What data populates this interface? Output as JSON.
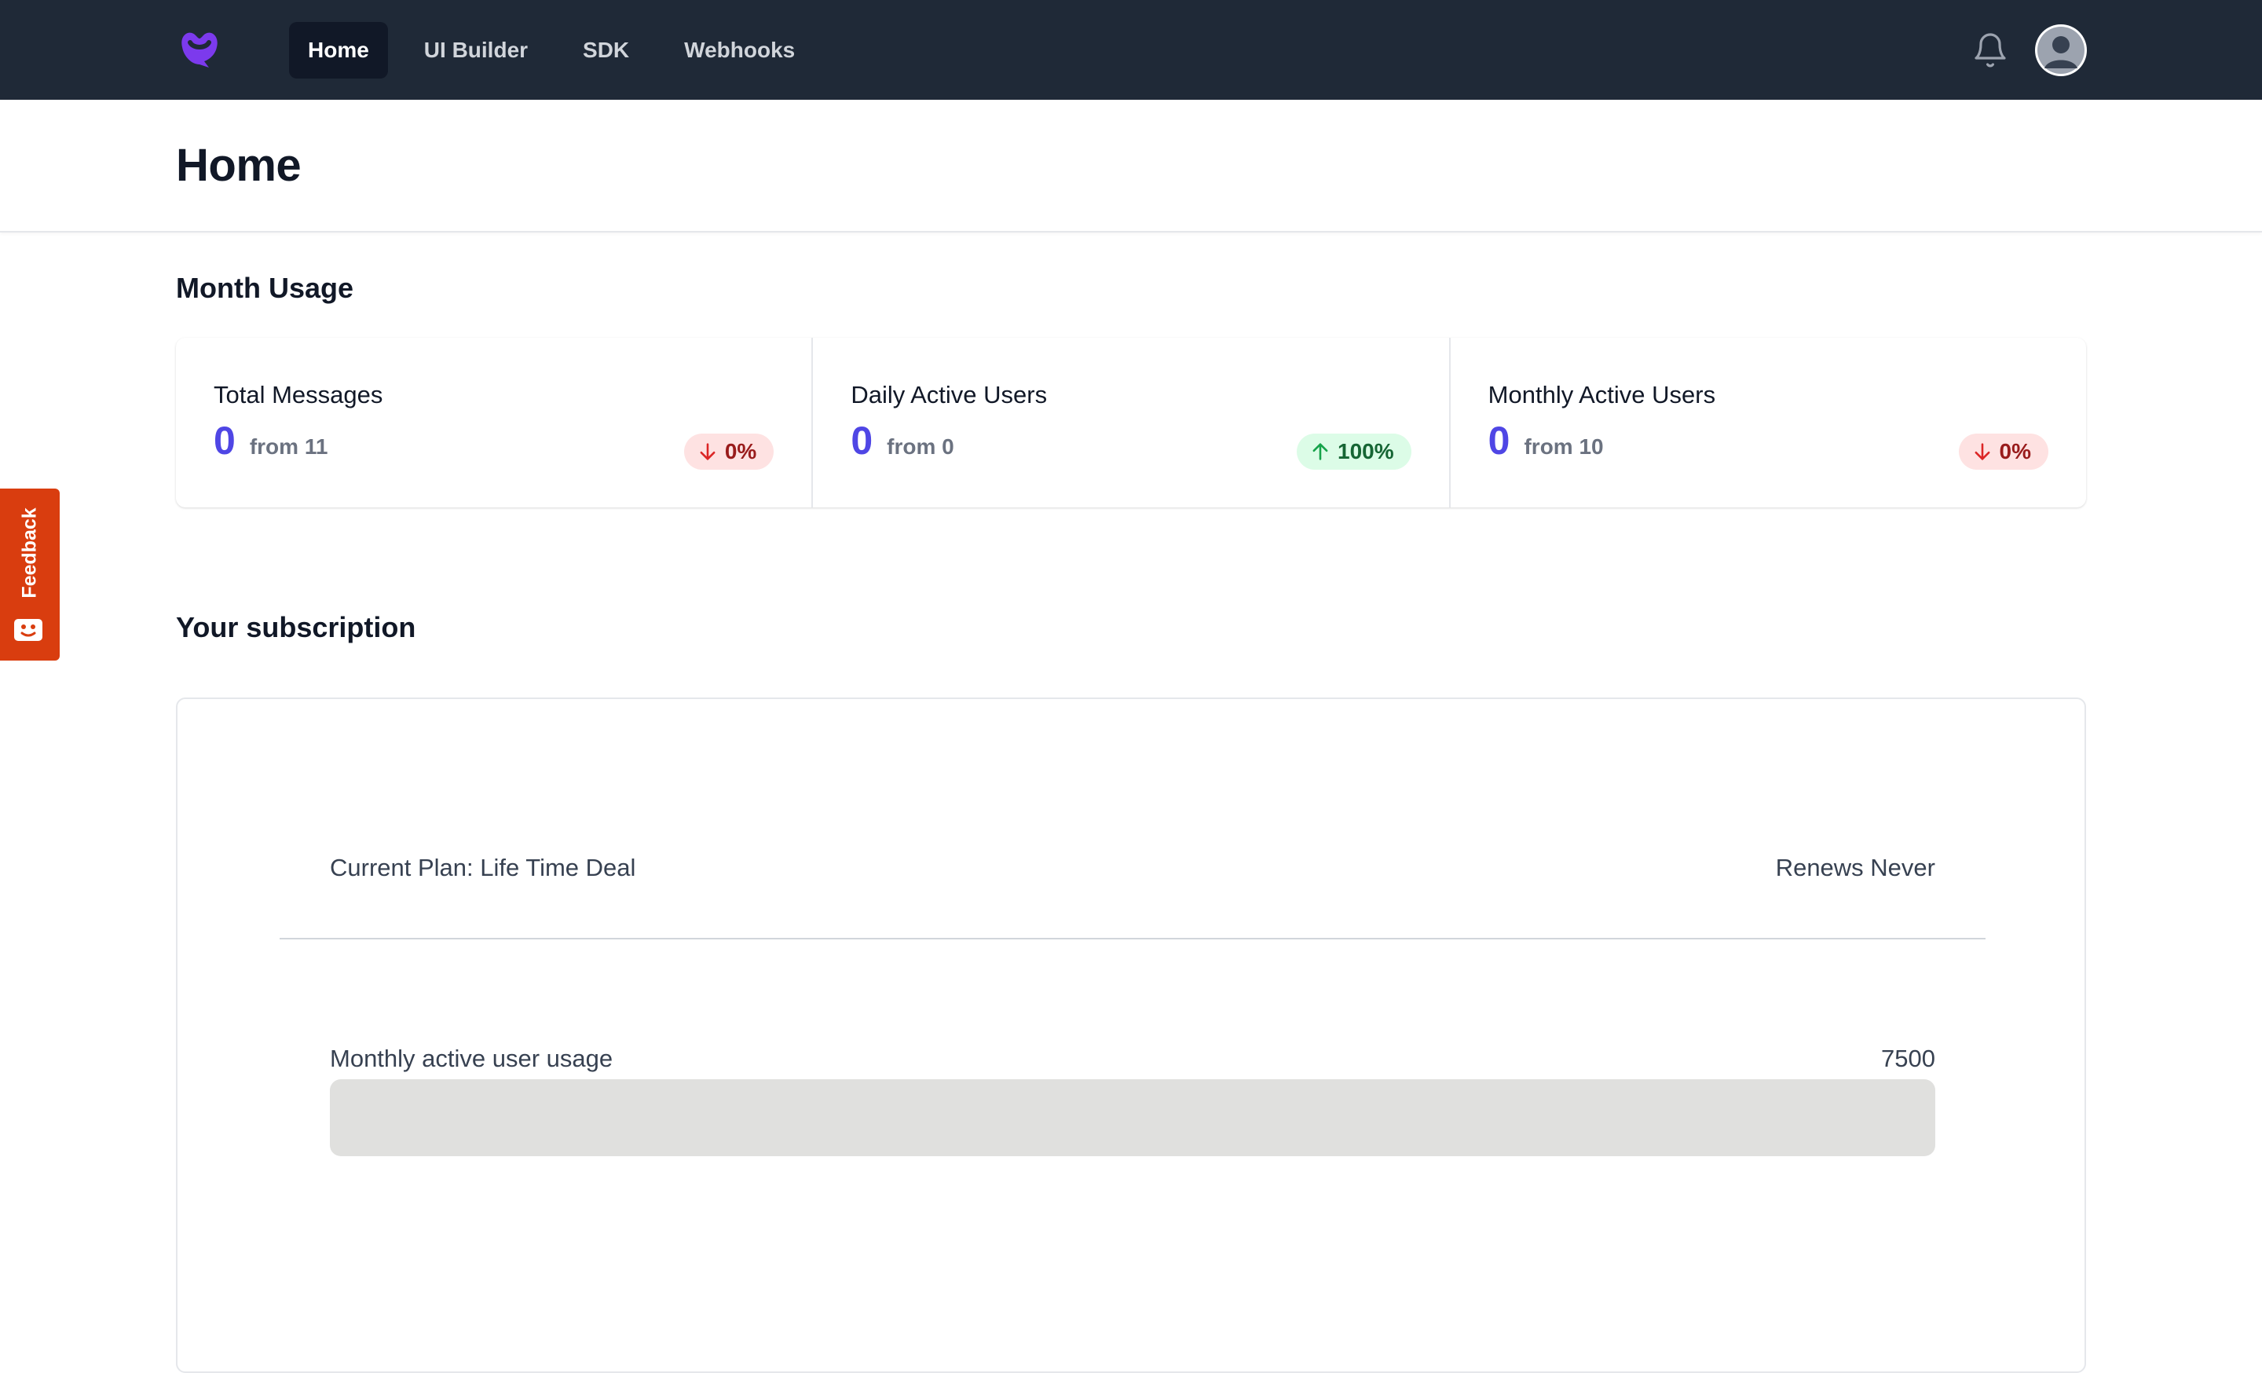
{
  "nav": {
    "tabs": [
      {
        "label": "Home",
        "active": true
      },
      {
        "label": "UI Builder",
        "active": false
      },
      {
        "label": "SDK",
        "active": false
      },
      {
        "label": "Webhooks",
        "active": false
      }
    ],
    "icons": {
      "logo": "brand-logo",
      "notifications": "bell-icon",
      "avatar": "user-avatar"
    }
  },
  "page": {
    "title": "Home"
  },
  "month_usage": {
    "title": "Month Usage",
    "stats": [
      {
        "label": "Total Messages",
        "value": "0",
        "from": "from 11",
        "change": "0%",
        "direction": "down"
      },
      {
        "label": "Daily Active Users",
        "value": "0",
        "from": "from 0",
        "change": "100%",
        "direction": "up"
      },
      {
        "label": "Monthly Active Users",
        "value": "0",
        "from": "from 10",
        "change": "0%",
        "direction": "down"
      }
    ]
  },
  "subscription": {
    "title": "Your subscription",
    "plan_label": "Current Plan: Life Time Deal",
    "renews_label": "Renews Never",
    "usage_label": "Monthly active user usage",
    "usage_limit": "7500",
    "usage_fraction": 0
  },
  "feedback": {
    "label": "Feedback"
  },
  "colors": {
    "nav_bg": "#1f2937",
    "accent": "#4f46e5",
    "down_bg": "#fee2e2",
    "down_text": "#991b1b",
    "up_bg": "#dcfce7",
    "up_text": "#166534",
    "feedback_bg": "#d93d0f",
    "logo": "#7c3aed"
  }
}
